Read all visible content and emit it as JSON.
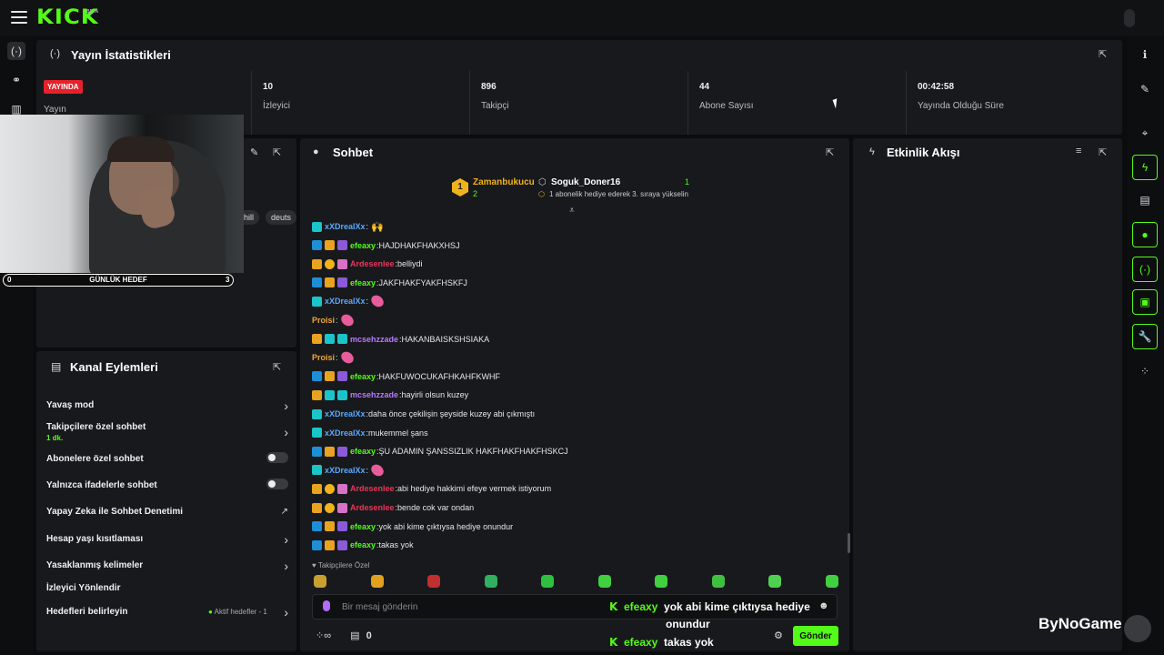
{
  "app": {
    "logo": "KICK",
    "logo_badge": "BETA"
  },
  "stats": {
    "title": "Yayın İstatistikleri",
    "live_badge": "YAYINDA",
    "stream_label": "Yayın",
    "cells": [
      {
        "value": "10",
        "label": "İzleyici"
      },
      {
        "value": "896",
        "label": "Takipçi"
      },
      {
        "value": "44",
        "label": "Abone Sayısı"
      },
      {
        "value": "00:42:58",
        "label": "Yayında Olduğu Süre"
      }
    ]
  },
  "stream_info": {
    "tags": [
      "hill",
      "deuts"
    ]
  },
  "goal": {
    "min": "0",
    "label": "GÜNLÜK HEDEF",
    "max": "3"
  },
  "actions": {
    "title": "Kanal Eylemleri",
    "items": [
      {
        "label": "Yavaş mod",
        "control": "chevron"
      },
      {
        "label": "Takipçilere özel sohbet",
        "sub": "1 dk.",
        "control": "chevron"
      },
      {
        "label": "Abonelere özel sohbet",
        "control": "toggle"
      },
      {
        "label": "Yalnızca ifadelerle sohbet",
        "control": "toggle"
      },
      {
        "label": "Yapay Zeka ile Sohbet Denetimi",
        "control": "external"
      },
      {
        "label": "Hesap yaşı kısıtlaması",
        "control": "chevron"
      },
      {
        "label": "Yasaklanmış kelimeler",
        "control": "chevron"
      },
      {
        "label": "İzleyici Yönlendir",
        "control": "none"
      },
      {
        "label": "Hedefleri belirleyin",
        "status": "Aktif hedefler - 1",
        "control": "chevron"
      }
    ]
  },
  "chat": {
    "title": "Sohbet",
    "pinned": {
      "rank": "1",
      "top_user": "Zamanbukucu",
      "top_count": "2",
      "second_user": "Soguk_Doner16",
      "second_count": "1",
      "note": "1 abonelik hediye ederek 3. sıraya yükselin"
    },
    "messages": [
      {
        "user": "xXDrealXx",
        "color": "#5aa9ff",
        "text": "",
        "emote": "hands",
        "badges": [
          "teal"
        ]
      },
      {
        "user": "efeaxy",
        "color": "#53fc18",
        "text": "HAJDHAKFHAKXHSJ",
        "badges": [
          "blue",
          "gold",
          "purp"
        ]
      },
      {
        "user": "Ardesenlee",
        "color": "#e8365a",
        "text": "belliydi",
        "badges": [
          "gold",
          "num",
          "pink"
        ]
      },
      {
        "user": "efeaxy",
        "color": "#53fc18",
        "text": "JAKFHAKFYAKFHSKFJ",
        "badges": [
          "blue",
          "gold",
          "purp"
        ]
      },
      {
        "user": "xXDrealXx",
        "color": "#5aa9ff",
        "text": "",
        "emote": "pink",
        "badges": [
          "teal"
        ]
      },
      {
        "user": "Proisi",
        "color": "#f0a63a",
        "text": "",
        "emote": "pink",
        "badges": []
      },
      {
        "user": "mcsehzzade",
        "color": "#b779ff",
        "text": "HAKANBAISKSHSIAKA",
        "badges": [
          "gold",
          "teal",
          "teal"
        ]
      },
      {
        "user": "Proisi",
        "color": "#f0a63a",
        "text": "",
        "emote": "pink",
        "badges": []
      },
      {
        "user": "efeaxy",
        "color": "#53fc18",
        "text": "HAKFUWOCUKAFHKAHFKWHF",
        "badges": [
          "blue",
          "gold",
          "purp"
        ]
      },
      {
        "user": "mcsehzzade",
        "color": "#b779ff",
        "text": "hayirli olsun kuzey",
        "badges": [
          "gold",
          "teal",
          "teal"
        ]
      },
      {
        "user": "xXDrealXx",
        "color": "#5aa9ff",
        "text": "daha önce çekilişin şeyside kuzey abi çıkmıştı",
        "badges": [
          "teal"
        ]
      },
      {
        "user": "xXDrealXx",
        "color": "#5aa9ff",
        "text": "mukemmel şans",
        "badges": [
          "teal"
        ]
      },
      {
        "user": "efeaxy",
        "color": "#53fc18",
        "text": "ŞU ADAMIN ŞANSSIZLIK HAKFHAKFHAKFHSKCJ",
        "badges": [
          "blue",
          "gold",
          "purp"
        ]
      },
      {
        "user": "xXDrealXx",
        "color": "#5aa9ff",
        "text": "",
        "emote": "pink",
        "badges": [
          "teal"
        ]
      },
      {
        "user": "Ardesenlee",
        "color": "#e8365a",
        "text": "abi hediye hakkimi efeye vermek istiyorum",
        "badges": [
          "gold",
          "num",
          "pink"
        ]
      },
      {
        "user": "Ardesenlee",
        "color": "#e8365a",
        "text": "bende cok var ondan",
        "badges": [
          "gold",
          "num",
          "pink"
        ]
      },
      {
        "user": "efeaxy",
        "color": "#53fc18",
        "text": "yok abi kime çıktıysa hediye onundur",
        "badges": [
          "blue",
          "gold",
          "purp"
        ]
      },
      {
        "user": "efeaxy",
        "color": "#53fc18",
        "text": "takas yok",
        "badges": [
          "blue",
          "gold",
          "purp"
        ]
      }
    ],
    "emote_bar_label": "Takipçilere Özel",
    "input_placeholder": "Bir mesaj gönderin",
    "points": "0",
    "send_label": "Gönder"
  },
  "overlay": {
    "lines": [
      {
        "user": "efeaxy",
        "text": "yok abi kime çıktıysa hediye",
        "cont": "onundur"
      },
      {
        "user": "efeaxy",
        "text": "takas yok"
      }
    ]
  },
  "activity": {
    "title": "Etkinlik Akışı"
  },
  "watermark": "ByNoGame"
}
